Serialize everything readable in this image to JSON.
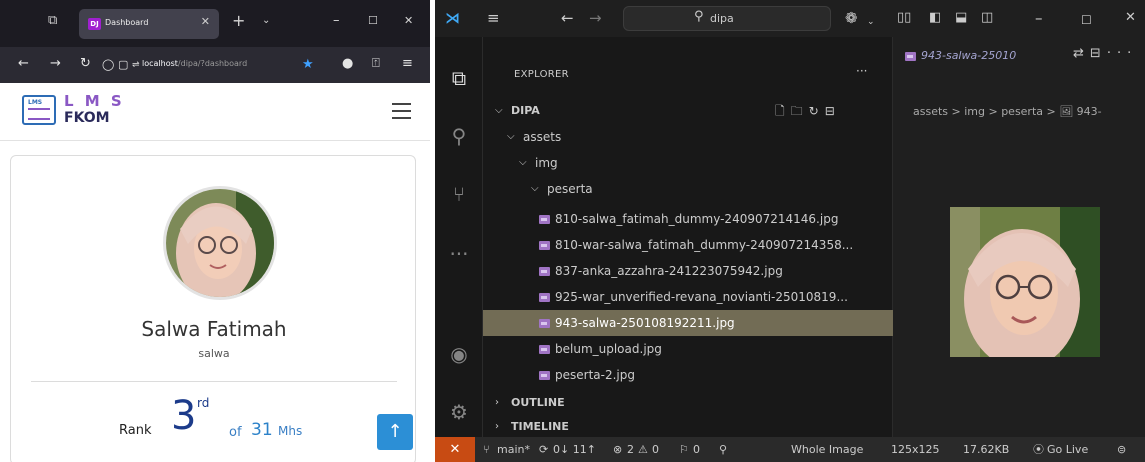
{
  "browser": {
    "tab_title": "Dashboard",
    "tab_favicon": "DJ",
    "url_host": "localhost",
    "url_path": "/dipa/?dashboard",
    "lms": {
      "logo_text": "LMS",
      "title_top": "L M S",
      "title_bottom": "FKOM"
    },
    "profile": {
      "name": "Salwa Fatimah",
      "username": "salwa",
      "rank_label": "Rank",
      "rank": "3",
      "rank_suffix": "rd",
      "of_label": "of",
      "total": "31",
      "unit": "Mhs"
    }
  },
  "vscode": {
    "search_text": "dipa",
    "explorer_title": "EXPLORER",
    "more_dots": "···",
    "root_folder": "DIPA",
    "tree": [
      {
        "label": "assets",
        "indent": 1,
        "chev": "v"
      },
      {
        "label": "img",
        "indent": 2,
        "chev": "v"
      },
      {
        "label": "peserta",
        "indent": 3,
        "chev": "v"
      }
    ],
    "files": [
      "810-salwa_fatimah_dummy-240907214146.jpg",
      "810-war-salwa_fatimah_dummy-240907214358...",
      "837-anka_azzahra-241223075942.jpg",
      "925-war_unverified-revana_novianti-25010819...",
      "943-salwa-250108192211.jpg",
      "belum_upload.jpg",
      "peserta-2.jpg"
    ],
    "selected_file": "943-salwa-250108192211.jpg",
    "outline_label": "OUTLINE",
    "timeline_label": "TIMELINE",
    "editor_tab": "943-salwa-25010",
    "breadcrumb": "assets > img > peserta > 🖼 943-",
    "status": {
      "branch": "main*",
      "sync": "0↓ 11↑",
      "errors": "2",
      "warnings": "0",
      "ports": "0",
      "whole_image": "Whole Image",
      "dimensions": "125x125",
      "filesize": "17.62KB",
      "go_live": "Go Live"
    },
    "accent_remote": "#c84b13",
    "selection_color": "#726c55"
  }
}
